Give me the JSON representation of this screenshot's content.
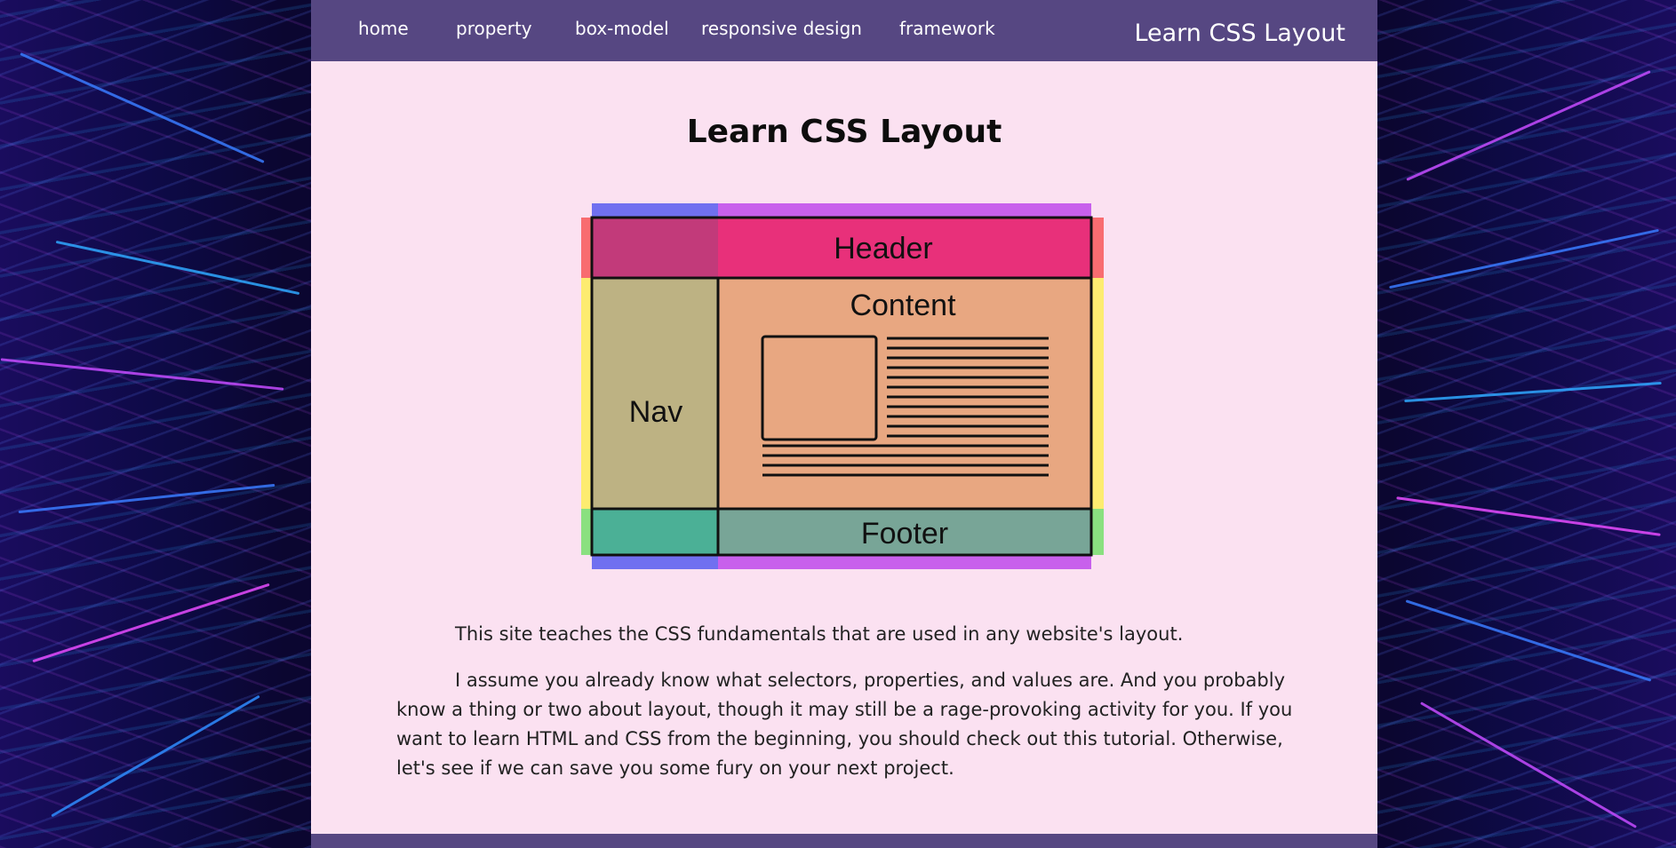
{
  "nav": {
    "items": [
      {
        "label": "home"
      },
      {
        "label": "property"
      },
      {
        "label": "box-model"
      },
      {
        "label": "responsive design"
      },
      {
        "label": "framework"
      }
    ],
    "brand": "Learn CSS Layout"
  },
  "main": {
    "title": "Learn CSS Layout",
    "diagram": {
      "header_label": "Header",
      "nav_label": "Nav",
      "content_label": "Content",
      "footer_label": "Footer"
    },
    "paragraphs": [
      "This site teaches the CSS fundamentals that are used in any website's layout.",
      "I assume you already know what selectors, properties, and values are. And you probably know a thing or two about layout, though it may still be a rage-provoking activity for you. If you want to learn HTML and CSS from the beginning, you should check out this tutorial. Otherwise, let's see if we can save you some fury on your next project."
    ]
  },
  "colors": {
    "nav_bg": "#564782",
    "page_bg": "#fbe1f1",
    "header_fill": "#e8307a",
    "nav_fill": "#bdb283",
    "content_fill": "#e8a781",
    "footer_fill": "#78a597"
  }
}
